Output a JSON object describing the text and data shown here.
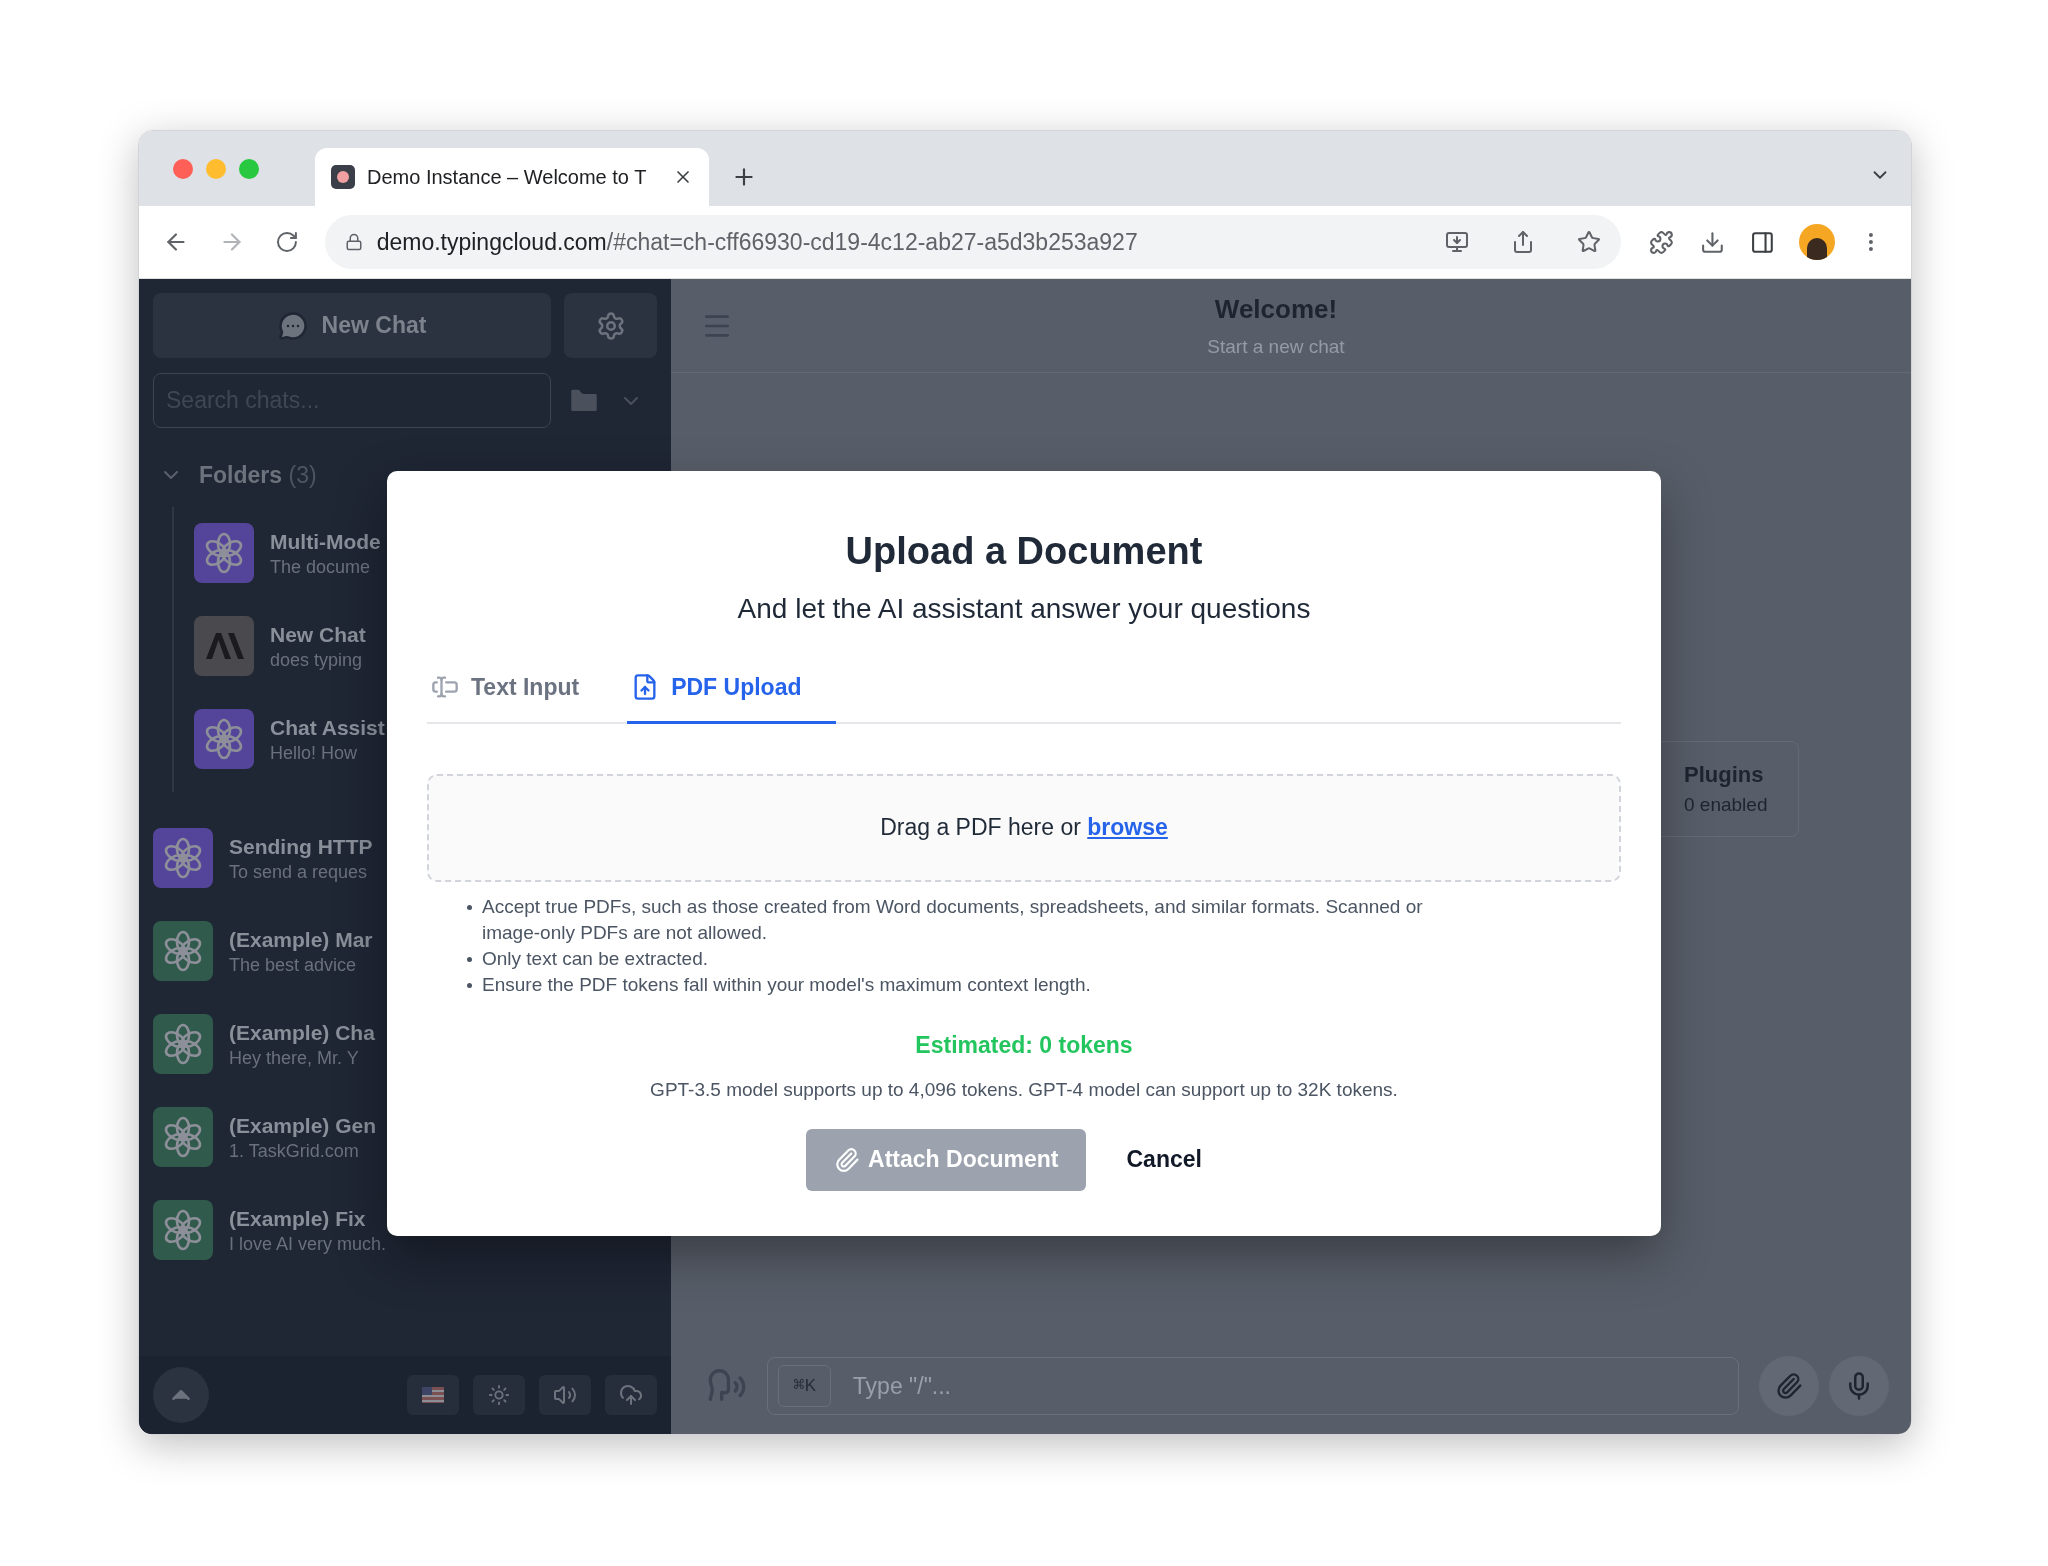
{
  "browser": {
    "tab": {
      "title": "Demo Instance – Welcome to T"
    },
    "url": {
      "host": "demo.typingcloud.com",
      "path": "/#chat=ch-cff66930-cd19-4c12-ab27-a5d3b253a927"
    }
  },
  "sidebar": {
    "new_chat": "New Chat",
    "search_placeholder": "Search chats...",
    "folders": {
      "label": "Folders",
      "count": "(3)",
      "expanded": true,
      "children": [
        {
          "title": "Multi-Mode",
          "preview": "The docume",
          "kind": "openai",
          "color": "#55459a"
        },
        {
          "title": "New Chat",
          "preview": "does typing",
          "kind": "anthropic",
          "color": "#4a4a4e"
        },
        {
          "title": "Chat Assist",
          "preview": "Hello! How",
          "kind": "openai",
          "color": "#55459a"
        }
      ]
    },
    "chats": [
      {
        "title": "Sending HTTP",
        "preview": "To send a reques",
        "kind": "openai",
        "color": "#55459a"
      },
      {
        "title": "(Example) Mar",
        "preview": "The best advice",
        "kind": "openai",
        "color": "#2f5a4c"
      },
      {
        "title": "(Example) Cha",
        "preview": "Hey there, Mr. Y",
        "kind": "openai",
        "color": "#2f5a4c"
      },
      {
        "title": "(Example) Gen",
        "preview": "1. TaskGrid.com",
        "kind": "openai",
        "color": "#2f5a4c"
      },
      {
        "title": "(Example) Fix",
        "preview": "I love AI very much.",
        "kind": "openai",
        "color": "#2f5a4c"
      }
    ]
  },
  "main": {
    "title": "Welcome!",
    "subtitle": "Start a new chat",
    "plugins": {
      "label": "Plugins",
      "status": "0 enabled"
    },
    "input": {
      "shortcut": "⌘K",
      "placeholder": "Type \"/\"..."
    }
  },
  "modal": {
    "title": "Upload a Document",
    "subtitle": "And let the AI assistant answer your questions",
    "tabs": [
      {
        "label": "Text Input",
        "kind": "text",
        "selected": false
      },
      {
        "label": "PDF Upload",
        "kind": "pdf",
        "selected": true
      }
    ],
    "dropzone": {
      "text": "Drag a PDF here or",
      "link": "browse"
    },
    "notes": [
      "Accept true PDFs, such as those created from Word documents, spreadsheets, and similar formats. Scanned or image-only PDFs are not allowed.",
      "Only text can be extracted.",
      "Ensure the PDF tokens fall within your model's maximum context length."
    ],
    "estimate": "Estimated: 0 tokens",
    "limits": "GPT-3.5 model supports up to 4,096 tokens. GPT-4 model can support up to 32K tokens.",
    "attach": {
      "label": "Attach Document",
      "disabled": true
    },
    "cancel": "Cancel"
  }
}
